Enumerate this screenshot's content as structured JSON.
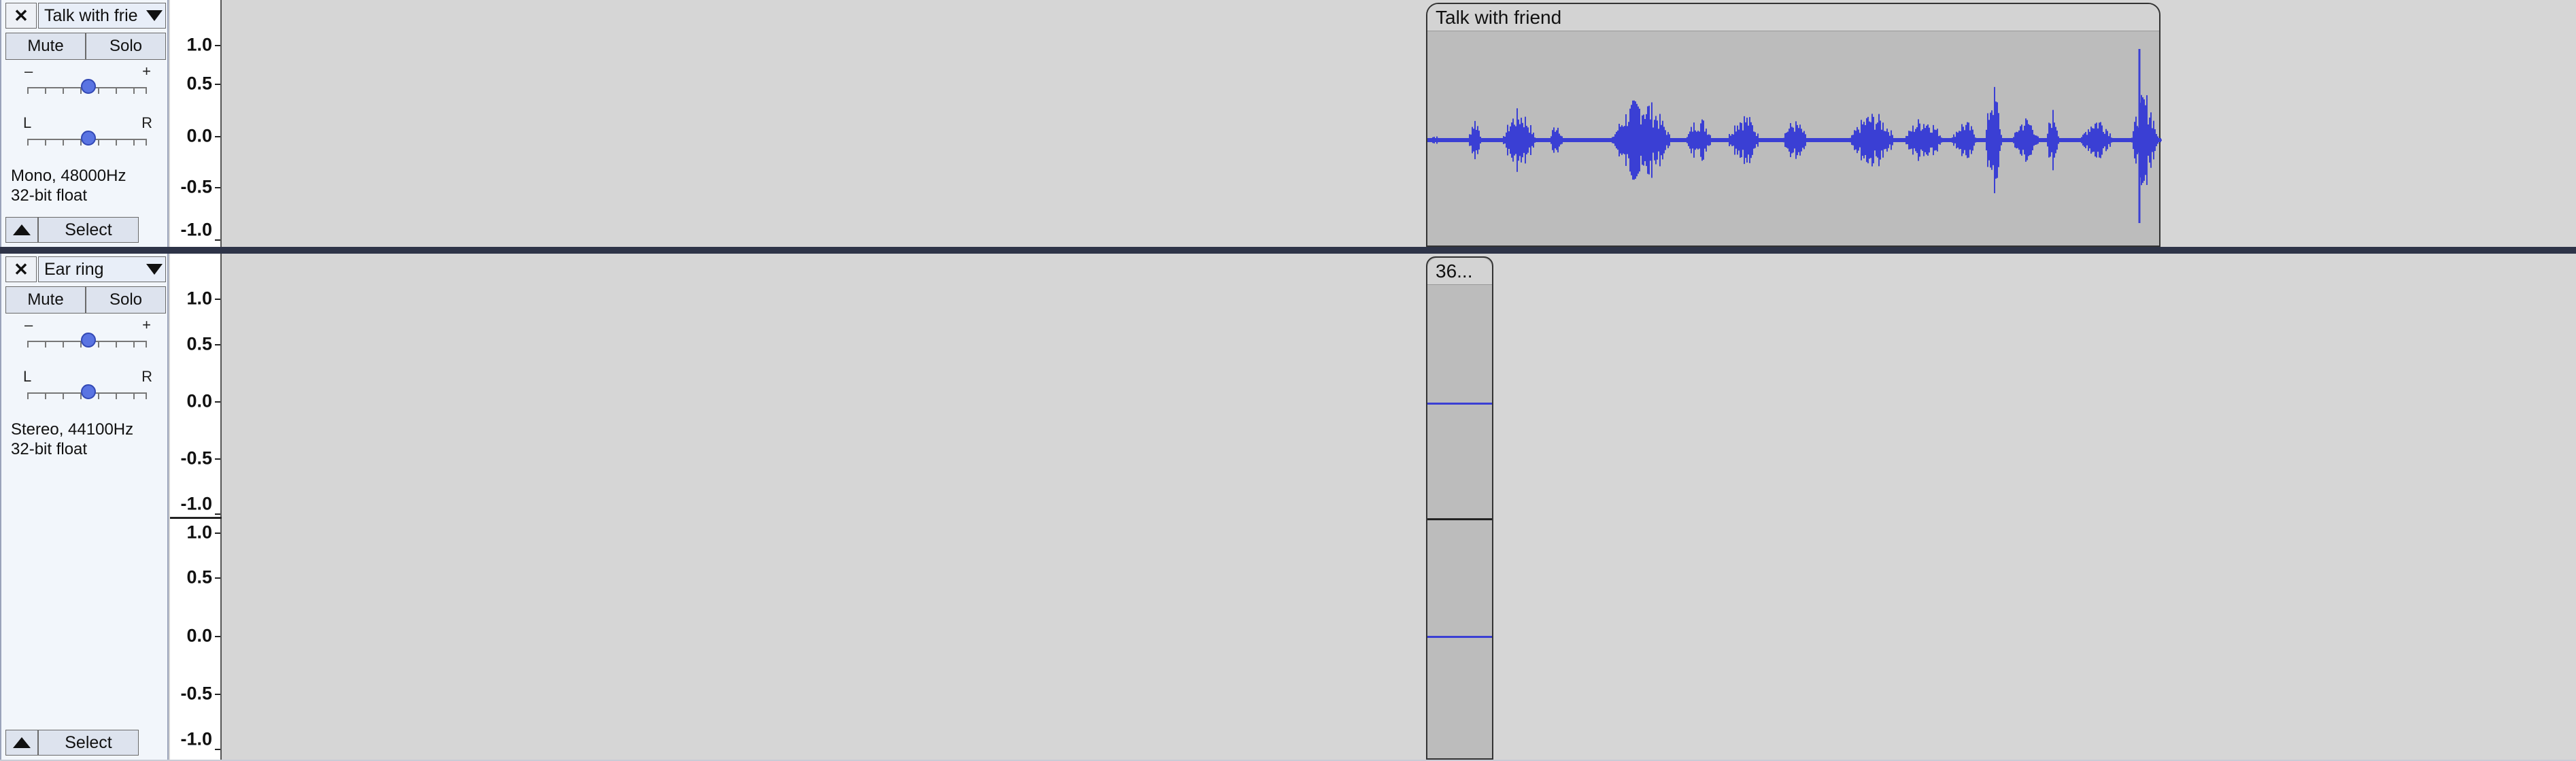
{
  "tracks": [
    {
      "name": "Talk with frie",
      "mute_label": "Mute",
      "solo_label": "Solo",
      "gain": {
        "minus": "–",
        "plus": "+",
        "level": 0.5
      },
      "pan": {
        "left": "L",
        "right": "R",
        "level": 0.5
      },
      "info": "Mono, 48000Hz\n32-bit float",
      "select_label": "Select",
      "ruler_labels": [
        "1.0",
        "0.5",
        "0.0",
        "-0.5",
        "-1.0"
      ],
      "clip_title": "Talk with friend"
    },
    {
      "name": "Ear ring",
      "mute_label": "Mute",
      "solo_label": "Solo",
      "gain": {
        "minus": "–",
        "plus": "+",
        "level": 0.5
      },
      "pan": {
        "left": "L",
        "right": "R",
        "level": 0.5
      },
      "info": "Stereo, 44100Hz\n32-bit float",
      "select_label": "Select",
      "ruler_labels": [
        "1.0",
        "0.5",
        "0.0",
        "-0.5",
        "-1.0"
      ],
      "ruler_labels_2": [
        "1.0",
        "0.5",
        "0.0",
        "-0.5",
        "-1.0"
      ],
      "clip_title": "36..."
    }
  ],
  "colors": {
    "waveform": "#3a3fd4",
    "clip_bg": "#bcbcbc",
    "track_bg": "#d6d6d6"
  }
}
